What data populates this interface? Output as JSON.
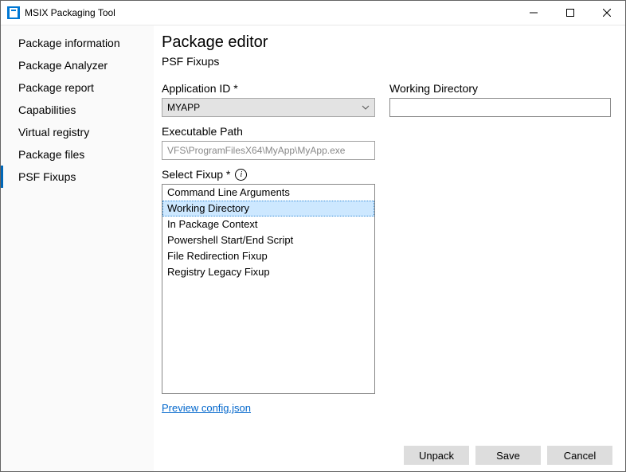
{
  "window": {
    "title": "MSIX Packaging Tool"
  },
  "sidebar": {
    "items": [
      {
        "label": "Package information"
      },
      {
        "label": "Package Analyzer"
      },
      {
        "label": "Package report"
      },
      {
        "label": "Capabilities"
      },
      {
        "label": "Virtual registry"
      },
      {
        "label": "Package files"
      },
      {
        "label": "PSF Fixups",
        "active": true
      }
    ]
  },
  "page": {
    "title": "Package editor",
    "subtitle": "PSF Fixups"
  },
  "form": {
    "appid_label": "Application ID *",
    "appid_value": "MYAPP",
    "exec_label": "Executable Path",
    "exec_value": "VFS\\ProgramFilesX64\\MyApp\\MyApp.exe",
    "fixup_label": "Select Fixup *",
    "fixup_options": [
      "Command Line Arguments",
      "Working Directory",
      "In Package Context",
      "Powershell Start/End Script",
      "File Redirection Fixup",
      "Registry Legacy Fixup"
    ],
    "fixup_selected_index": 1,
    "preview_link": "Preview config.json"
  },
  "detail": {
    "working_dir_label": "Working Directory",
    "working_dir_value": ""
  },
  "footer": {
    "unpack": "Unpack",
    "save": "Save",
    "cancel": "Cancel"
  }
}
